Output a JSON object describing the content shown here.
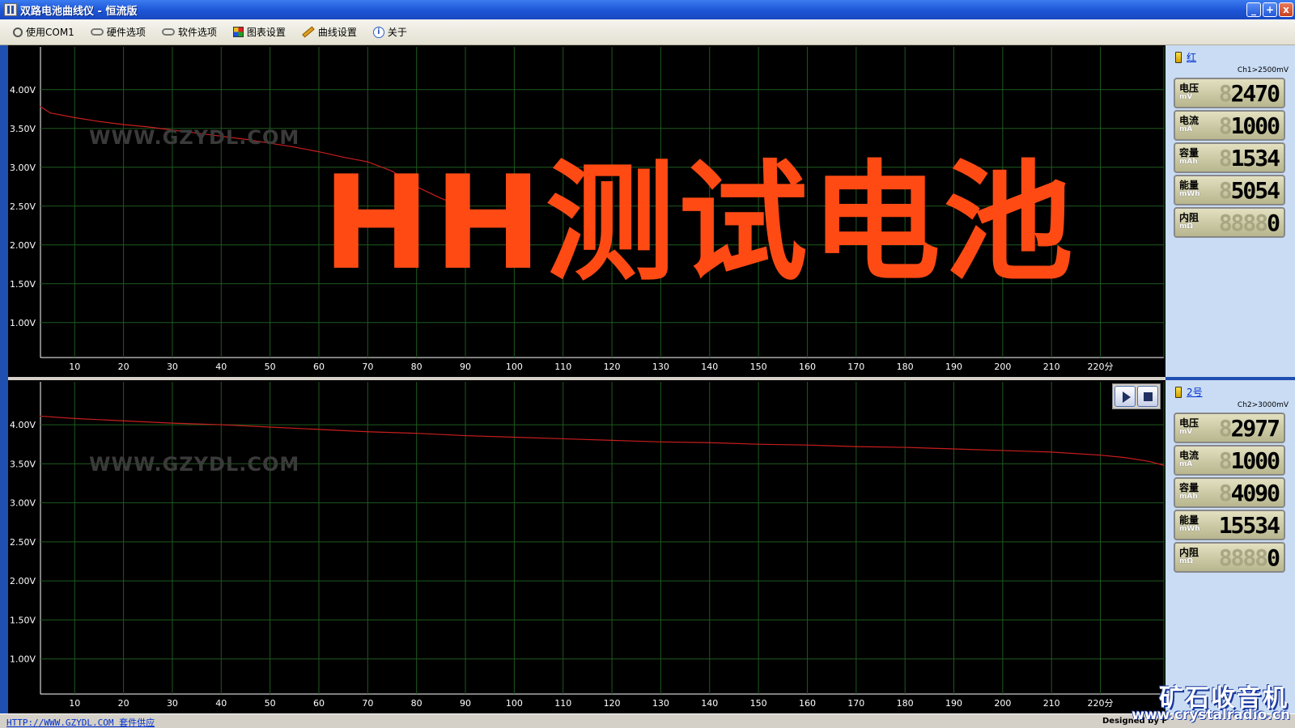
{
  "window": {
    "title": "双路电池曲线仪 - 恒流版",
    "min_label": "_",
    "max_label": "+",
    "close_label": "x"
  },
  "menu": [
    {
      "label": "使用COM1",
      "icon": "plug-icon"
    },
    {
      "label": "硬件选项",
      "icon": "chain-icon"
    },
    {
      "label": "软件选项",
      "icon": "chain-icon"
    },
    {
      "label": "图表设置",
      "icon": "grid-color-icon"
    },
    {
      "label": "曲线设置",
      "icon": "pencil-icon"
    },
    {
      "label": "关于",
      "icon": "info-icon"
    }
  ],
  "watermark": "WWW.GZYDL.COM",
  "overlay_text": "HH测试电池",
  "colors": {
    "curve": "#c81e1e",
    "grid": "#1e5a1e",
    "axis_text": "#ffffff",
    "overlay": "#ff4a14",
    "panel_bg": "#c9dcf4"
  },
  "chart_data": [
    {
      "type": "line",
      "title": "",
      "xlabel": "",
      "ylabel": "",
      "x_ticks": [
        10,
        20,
        30,
        40,
        50,
        60,
        70,
        80,
        90,
        100,
        110,
        120,
        130,
        140,
        150,
        160,
        170,
        180,
        190,
        200,
        210,
        220
      ],
      "x_tick_labels": [
        "10",
        "20",
        "30",
        "40",
        "50",
        "60",
        "70",
        "80",
        "90",
        "100",
        "110",
        "120",
        "130",
        "140",
        "150",
        "160",
        "170",
        "180",
        "190",
        "200",
        "210",
        "220分"
      ],
      "y_ticks": [
        1.0,
        1.5,
        2.0,
        2.5,
        3.0,
        3.5,
        4.0
      ],
      "y_tick_labels": [
        "1.00V",
        "1.50V",
        "2.00V",
        "2.50V",
        "3.00V",
        "3.50V",
        "4.00V"
      ],
      "xlim": [
        3,
        233
      ],
      "ylim": [
        0.55,
        4.55
      ],
      "grid": true,
      "series": [
        {
          "x": [
            0,
            5,
            10,
            15,
            20,
            25,
            30,
            35,
            40,
            45,
            50,
            55,
            60,
            65,
            70,
            75,
            80,
            85,
            90
          ],
          "y": [
            3.78,
            3.7,
            3.64,
            3.59,
            3.55,
            3.52,
            3.48,
            3.44,
            3.4,
            3.36,
            3.31,
            3.26,
            3.2,
            3.13,
            3.07,
            2.95,
            2.75,
            2.6,
            2.48
          ]
        }
      ]
    },
    {
      "type": "line",
      "title": "",
      "xlabel": "",
      "ylabel": "",
      "x_ticks": [
        10,
        20,
        30,
        40,
        50,
        60,
        70,
        80,
        90,
        100,
        110,
        120,
        130,
        140,
        150,
        160,
        170,
        180,
        190,
        200,
        210,
        220
      ],
      "x_tick_labels": [
        "10",
        "20",
        "30",
        "40",
        "50",
        "60",
        "70",
        "80",
        "90",
        "100",
        "110",
        "120",
        "130",
        "140",
        "150",
        "160",
        "170",
        "180",
        "190",
        "200",
        "210",
        "220分"
      ],
      "y_ticks": [
        1.0,
        1.5,
        2.0,
        2.5,
        3.0,
        3.5,
        4.0
      ],
      "y_tick_labels": [
        "1.00V",
        "1.50V",
        "2.00V",
        "2.50V",
        "3.00V",
        "3.50V",
        "4.00V"
      ],
      "xlim": [
        3,
        233
      ],
      "ylim": [
        0.55,
        4.55
      ],
      "grid": true,
      "series": [
        {
          "x": [
            0,
            10,
            20,
            30,
            40,
            50,
            60,
            70,
            80,
            90,
            100,
            110,
            120,
            130,
            140,
            150,
            160,
            170,
            180,
            190,
            200,
            210,
            220,
            225,
            230,
            233
          ],
          "y": [
            4.11,
            4.08,
            4.05,
            4.02,
            4.0,
            3.97,
            3.94,
            3.91,
            3.89,
            3.86,
            3.84,
            3.82,
            3.8,
            3.78,
            3.77,
            3.75,
            3.74,
            3.72,
            3.71,
            3.69,
            3.67,
            3.65,
            3.61,
            3.58,
            3.53,
            3.48
          ]
        }
      ]
    }
  ],
  "channels": [
    {
      "name": "红",
      "setting": "Ch1>2500mV",
      "meters": [
        {
          "name": "电压",
          "unit": "mV",
          "ghost": "8",
          "value": "2470"
        },
        {
          "name": "电流",
          "unit": "mA",
          "ghost": "8",
          "value": "1000"
        },
        {
          "name": "容量",
          "unit": "mAh",
          "ghost": "8",
          "value": "1534"
        },
        {
          "name": "能量",
          "unit": "mWh",
          "ghost": "8",
          "value": "5054"
        },
        {
          "name": "内阻",
          "unit": "mΩ",
          "ghost": "8888",
          "value": "0"
        }
      ]
    },
    {
      "name": "2号",
      "setting": "Ch2>3000mV",
      "meters": [
        {
          "name": "电压",
          "unit": "mV",
          "ghost": "8",
          "value": "2977"
        },
        {
          "name": "电流",
          "unit": "mA",
          "ghost": "8",
          "value": "1000"
        },
        {
          "name": "容量",
          "unit": "mAh",
          "ghost": "8",
          "value": "4090"
        },
        {
          "name": "能量",
          "unit": "mWh",
          "ghost": "",
          "value": "15534"
        },
        {
          "name": "内阻",
          "unit": "mΩ",
          "ghost": "8888",
          "value": "0"
        }
      ]
    }
  ],
  "status": {
    "link": "HTTP://WWW.GZYDL.COM 套件供应",
    "designer": "Designed by F"
  },
  "logo": {
    "cn": "矿石收音机",
    "url": "www.crystalradio.cn"
  }
}
